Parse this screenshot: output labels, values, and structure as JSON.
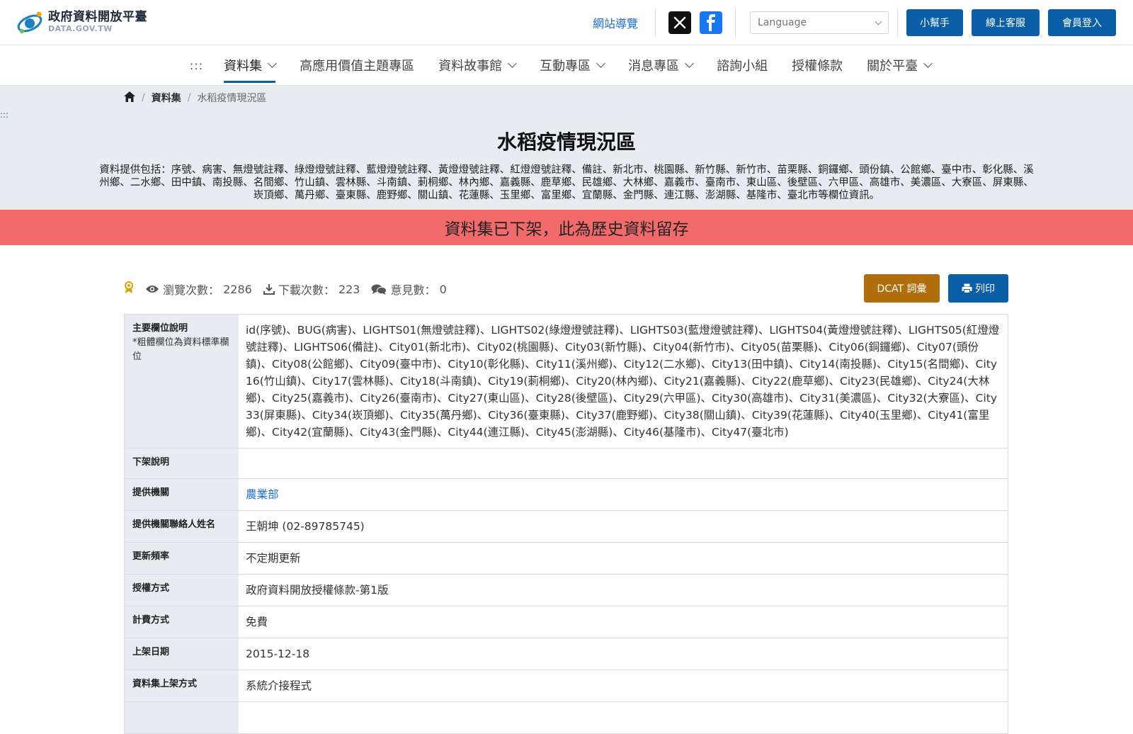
{
  "header": {
    "logo_zh": "政府資料開放平臺",
    "logo_en": "DATA.GOV.TW",
    "sitemap": "網站導覽",
    "language_placeholder": "Language",
    "btn_helper": "小幫手",
    "btn_service": "線上客服",
    "btn_login": "會員登入",
    "colors": {
      "primary": "#0a5fa6",
      "x": "#111111",
      "facebook": "#1877f2"
    }
  },
  "nav": {
    "accesskey": ":::",
    "items": [
      {
        "label": "資料集",
        "dropdown": true,
        "active": true
      },
      {
        "label": "高應用價值主題專區",
        "dropdown": false
      },
      {
        "label": "資料故事館",
        "dropdown": true
      },
      {
        "label": "互動專區",
        "dropdown": true
      },
      {
        "label": "消息專區",
        "dropdown": true
      },
      {
        "label": "諮詢小組",
        "dropdown": false
      },
      {
        "label": "授權條款",
        "dropdown": false
      },
      {
        "label": "關於平臺",
        "dropdown": true
      }
    ]
  },
  "breadcrumb": {
    "level1": "資料集",
    "current": "水稻疫情現況區"
  },
  "hero": {
    "accesskey": ":::",
    "title": "水稻疫情現況區",
    "description": "資料提供包括：序號、病害、無燈號註釋、綠燈燈號註釋、藍燈燈號註釋、黃燈燈號註釋、紅燈燈號註釋、備註、新北市、桃園縣、新竹縣、新竹市、苗栗縣、銅鑼鄉、頭份鎮、公館鄉、臺中市、彰化縣、溪州鄉、二水鄉、田中鎮、南投縣、名間鄉、竹山鎮、雲林縣、斗南鎮、莿桐鄉、林內鄉、嘉義縣、鹿草鄉、民雄鄉、大林鄉、嘉義市、臺南市、東山區、後壁區、六甲區、高雄市、美濃區、大寮區、屏東縣、崁頂鄉、萬丹鄉、臺東縣、鹿野鄉、關山鎮、花蓮縣、玉里鄉、富里鄉、宜蘭縣、金門縣、連江縣、澎湖縣、基隆市、臺北市等欄位資訊。"
  },
  "banner": {
    "text": "資料集已下架，此為歷史資料留存",
    "color": "#f16b6b"
  },
  "stats": {
    "views_label": "瀏覽次數：",
    "views": "2286",
    "downloads_label": "下載次數：",
    "downloads": "223",
    "comments_label": "意見數：",
    "comments": "0"
  },
  "actions": {
    "dcat": "DCAT 詞彙",
    "print": "列印"
  },
  "info": {
    "fields_label": "主要欄位說明",
    "fields_note": "*粗體欄位為資料標準欄位",
    "fields_value": "id(序號)、BUG(病害)、LIGHTS01(無燈號註釋)、LIGHTS02(綠燈燈號註釋)、LIGHTS03(藍燈燈號註釋)、LIGHTS04(黃燈燈號註釋)、LIGHTS05(紅燈燈號註釋)、LIGHTS06(備註)、City01(新北市)、City02(桃園縣)、City03(新竹縣)、City04(新竹市)、City05(苗栗縣)、City06(銅鑼鄉)、City07(頭份鎮)、City08(公館鄉)、City09(臺中市)、City10(彰化縣)、City11(溪州鄉)、City12(二水鄉)、City13(田中鎮)、City14(南投縣)、City15(名間鄉)、City16(竹山鎮)、City17(雲林縣)、City18(斗南鎮)、City19(莿桐鄉)、City20(林內鄉)、City21(嘉義縣)、City22(鹿草鄉)、City23(民雄鄉)、City24(大林鄉)、City25(嘉義市)、City26(臺南市)、City27(東山區)、City28(後壁區)、City29(六甲區)、City30(高雄市)、City31(美濃區)、City32(大寮區)、City33(屏東縣)、City34(崁頂鄉)、City35(萬丹鄉)、City36(臺東縣)、City37(鹿野鄉)、City38(關山鎮)、City39(花蓮縣)、City40(玉里鄉)、City41(富里鄉)、City42(宜蘭縣)、City43(金門縣)、City44(連江縣)、City45(澎湖縣)、City46(基隆市)、City47(臺北市)",
    "removal_label": "下架說明",
    "removal_value": "",
    "provider_label": "提供機關",
    "provider_value": "農業部",
    "contact_label": "提供機關聯絡人姓名",
    "contact_value": "王朝坤 (02-89785745)",
    "frequency_label": "更新頻率",
    "frequency_value": "不定期更新",
    "license_label": "授權方式",
    "license_value": "政府資料開放授權條款-第1版",
    "fee_label": "計費方式",
    "fee_value": "免費",
    "published_label": "上架日期",
    "published_value": "2015-12-18",
    "method_label": "資料集上架方式",
    "method_value": "系統介接程式"
  }
}
